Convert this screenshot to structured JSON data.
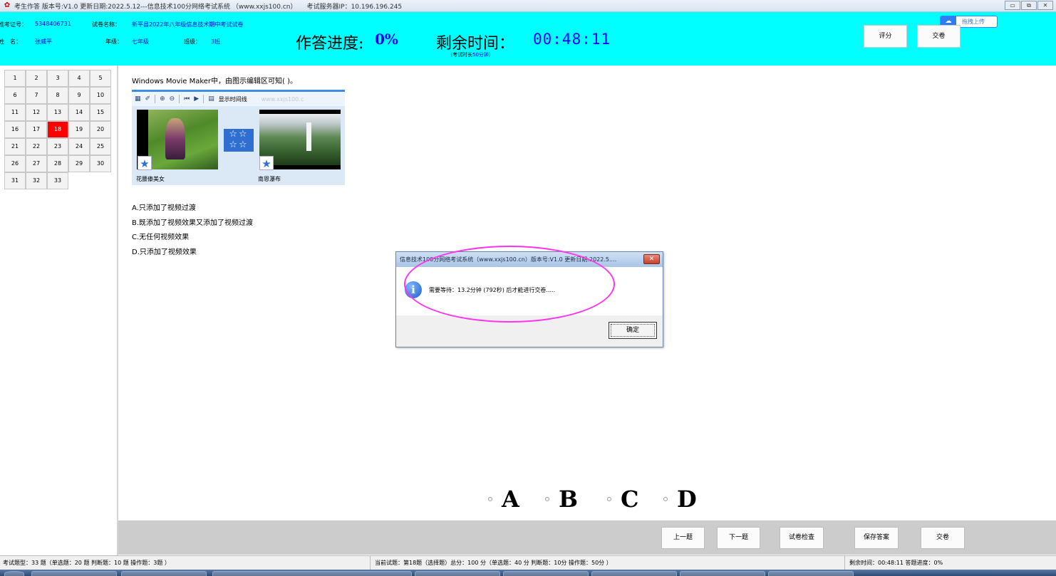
{
  "titlebar": {
    "title": "考生作答 版本号:V1.0 更新日期:2022.5.12---信息技术100分网络考试系统 （www.xxjs100.cn）",
    "server": "考试服务器IP：10.196.196.245",
    "icon": "exam-app-icon",
    "buttons": [
      "▭",
      "⧉",
      "✕"
    ]
  },
  "header": {
    "ticket_label": "准考证号：",
    "ticket_value": "5348406731",
    "paper_label": "试卷名称：",
    "paper_value": "新平县2022年八年级信息技术期中考试试卷",
    "name_label": "姓　名：",
    "name_value": "张威平",
    "grade_label": "年级：",
    "grade_value": "七年级",
    "class_label": "班级：",
    "class_value": "3班",
    "progress_label": "作答进度:",
    "progress_value": "0%",
    "remain_label": "剩余时间：",
    "remain_value": "00:48:11",
    "duration_prefix": "（考试时长",
    "duration_value": "50分钟",
    "duration_suffix": "）",
    "score_button": "评分",
    "submit_button": "交卷",
    "baidu_text": "拖拽上传"
  },
  "grid": {
    "current": 18,
    "questions": [
      "1",
      "2",
      "3",
      "4",
      "5",
      "6",
      "7",
      "8",
      "9",
      "10",
      "11",
      "12",
      "13",
      "14",
      "15",
      "16",
      "17",
      "18",
      "19",
      "20",
      "21",
      "22",
      "23",
      "24",
      "25",
      "26",
      "27",
      "28",
      "29",
      "30",
      "31",
      "32",
      "33"
    ],
    "current_color": "#ff0000"
  },
  "question": {
    "text": "Windows Movie Maker中，由图示编辑区可知( )。",
    "toolbar_label": "显示时间线",
    "watermark": "www.xxjs100.c",
    "clip1_name": "花腰傣美女",
    "clip2_name": "南恩瀑布",
    "options": [
      "A.只添加了视频过渡",
      "B.既添加了视频效果又添加了视频过渡",
      "C.无任何视频效果",
      "D.只添加了视频效果"
    ]
  },
  "dialog": {
    "title": "信息技术100分网络考试系统（www.xxjs100.cn）版本号:V1.0 更新日期:2022.5....",
    "message": "需要等待：13.2分钟 (792秒) 后才能进行交卷.....",
    "ok_label": "确定",
    "close_label": "✕",
    "highlight_color": "#ff33ee"
  },
  "answers": [
    "A",
    "B",
    "C",
    "D"
  ],
  "actions": {
    "prev": "上一题",
    "next": "下一题",
    "check": "试卷检查",
    "save": "保存答案",
    "submit": "交卷"
  },
  "status": {
    "left": "考试题型：33 题（单选题：20 题 判断题：10 题 操作题：3题 ）",
    "middle": "当前试题：第18题（选择题）总分：100 分（单选题：40 分 判断题：10分 操作题：50分 ）",
    "right": "剩余时间：00:48:11 答题进度：0%"
  },
  "colors": {
    "header_bg": "#00ffff",
    "accent_blue": "#0000ff",
    "action_bar_bg": "#cccccc"
  }
}
